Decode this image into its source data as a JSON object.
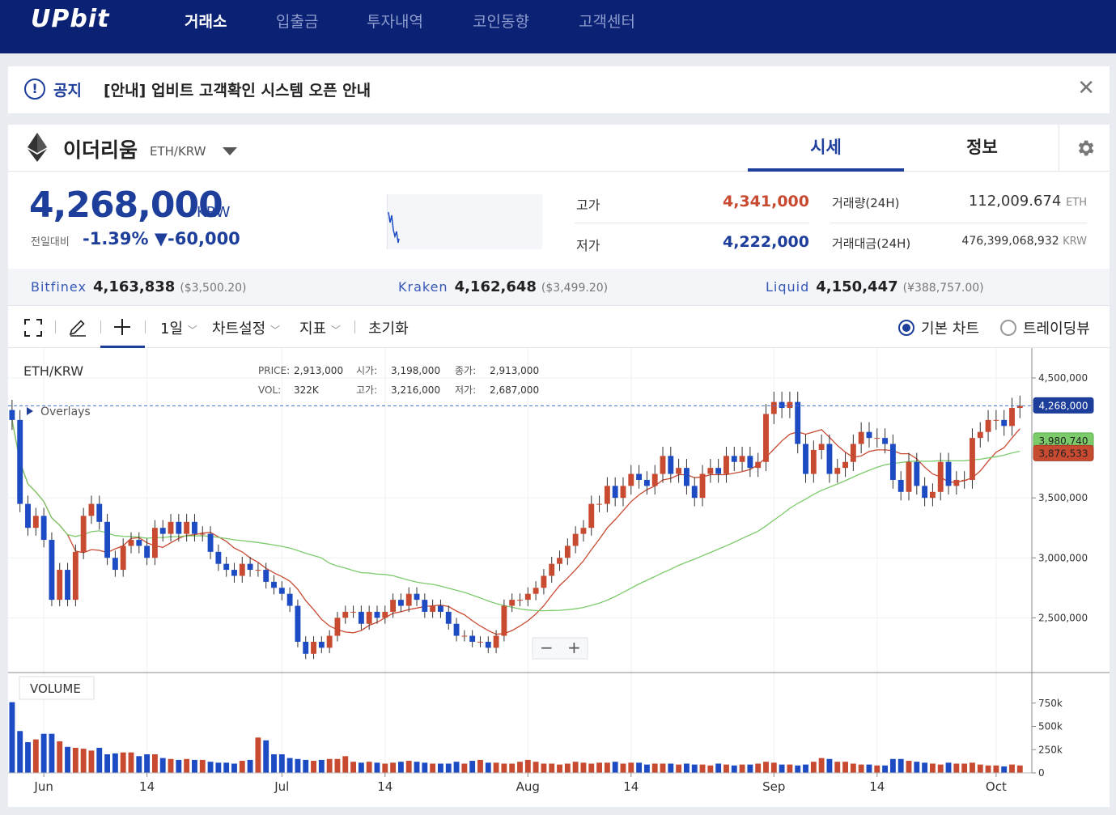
{
  "nav": {
    "logo": "UPbit",
    "items": [
      {
        "label": "거래소",
        "active": true
      },
      {
        "label": "입출금",
        "active": false
      },
      {
        "label": "투자내역",
        "active": false
      },
      {
        "label": "코인동향",
        "active": false
      },
      {
        "label": "고객센터",
        "active": false
      }
    ]
  },
  "notice": {
    "icon": "!",
    "label": "공지",
    "text": "[안내] 업비트 고객확인 시스템 오픈 안내",
    "close": "✕"
  },
  "coin": {
    "name": "이더리움",
    "pair": "ETH/KRW",
    "tabs": {
      "price": "시세",
      "info": "정보"
    },
    "price": "4,268,000",
    "price_unit": "KRW",
    "change_label": "전일대비",
    "change_pct": "-1.39%",
    "change_amt": "▼-60,000",
    "high_label": "고가",
    "high": "4,341,000",
    "low_label": "저가",
    "low": "4,222,000",
    "volume_label": "거래량(24H)",
    "volume": "112,009.674",
    "volume_unit": "ETH",
    "amount_label": "거래대금(24H)",
    "amount": "476,399,068,932",
    "amount_unit": "KRW"
  },
  "exchanges": [
    {
      "name": "Bitfinex",
      "price": "4,163,838",
      "foreign": "($3,500.20)"
    },
    {
      "name": "Kraken",
      "price": "4,162,648",
      "foreign": "($3,499.20)"
    },
    {
      "name": "Liquid",
      "price": "4,150,447",
      "foreign": "(¥388,757.00)"
    }
  ],
  "toolbar": {
    "interval": "1일",
    "chart_settings": "차트설정",
    "indicators": "지표",
    "reset": "초기화",
    "basic_chart": "기본 차트",
    "tradingview": "트레이딩뷰"
  },
  "colors": {
    "up": "#c84a31",
    "down": "#1d4bc4",
    "ma_short": "#c84a31",
    "ma_long": "#7ccb6b",
    "brand": "#0a2174"
  },
  "chart_data": {
    "type": "candlestick",
    "symbol": "ETH/KRW",
    "overlays_label": "Overlays",
    "volume_label": "VOLUME",
    "legend": {
      "price_label": "PRICE:",
      "price": "2,913,000",
      "open_label": "시가:",
      "open": "3,198,000",
      "close_label": "종가:",
      "close": "2,913,000",
      "vol_label": "VOL:",
      "vol": "322K",
      "high_label": "고가:",
      "high": "3,216,000",
      "low_label": "저가:",
      "low": "2,687,000"
    },
    "y_ticks": [
      "4,500,000",
      "3,500,000",
      "3,000,000",
      "2,500,000"
    ],
    "y_tick_values": [
      4500000,
      3500000,
      3000000,
      2500000
    ],
    "volume_ticks": [
      "750k",
      "500k",
      "250k",
      "0"
    ],
    "volume_tick_values": [
      750000,
      500000,
      250000,
      0
    ],
    "x_labels": [
      "Jun",
      "14",
      "Jul",
      "14",
      "Aug",
      "14",
      "Sep",
      "14",
      "Oct"
    ],
    "x_label_days": [
      4,
      17,
      34,
      47,
      65,
      78,
      96,
      109,
      124
    ],
    "last_price": 4268000,
    "last_price_label": "4,268,000",
    "ma_long_last": "3,980,740",
    "ma_short_last": "3,876,533",
    "ylim": [
      2050000,
      4750000
    ],
    "closes": [
      4150000,
      3450000,
      3250000,
      3350000,
      3150000,
      2650000,
      2900000,
      2650000,
      3050000,
      3350000,
      3450000,
      3300000,
      3000000,
      2900000,
      3100000,
      3150000,
      3100000,
      3000000,
      3250000,
      3200000,
      3300000,
      3200000,
      3300000,
      3200000,
      3200000,
      3050000,
      2950000,
      2900000,
      2850000,
      2950000,
      2900000,
      2900000,
      2800000,
      2750000,
      2700000,
      2600000,
      2300000,
      2200000,
      2300000,
      2250000,
      2350000,
      2500000,
      2550000,
      2550000,
      2450000,
      2550000,
      2500000,
      2550000,
      2650000,
      2600000,
      2700000,
      2650000,
      2550000,
      2600000,
      2550000,
      2450000,
      2350000,
      2350000,
      2300000,
      2300000,
      2250000,
      2350000,
      2600000,
      2650000,
      2650000,
      2700000,
      2750000,
      2850000,
      2950000,
      3000000,
      3100000,
      3200000,
      3250000,
      3450000,
      3450000,
      3600000,
      3500000,
      3600000,
      3700000,
      3650000,
      3600000,
      3700000,
      3850000,
      3700000,
      3750000,
      3600000,
      3500000,
      3700000,
      3750000,
      3700000,
      3850000,
      3800000,
      3850000,
      3750000,
      3800000,
      4200000,
      4300000,
      4250000,
      4300000,
      3950000,
      3700000,
      3900000,
      3950000,
      3700000,
      3750000,
      3800000,
      3950000,
      4050000,
      4000000,
      4000000,
      3950000,
      3650000,
      3550000,
      3800000,
      3600000,
      3500000,
      3550000,
      3800000,
      3600000,
      3650000,
      3650000,
      4000000,
      4050000,
      4150000,
      4150000,
      4100000,
      4250000,
      4268000
    ],
    "volumes": [
      760000,
      450000,
      330000,
      360000,
      420000,
      420000,
      340000,
      280000,
      270000,
      260000,
      240000,
      270000,
      200000,
      210000,
      220000,
      220000,
      180000,
      200000,
      200000,
      160000,
      150000,
      140000,
      150000,
      140000,
      140000,
      120000,
      110000,
      110000,
      100000,
      130000,
      140000,
      380000,
      350000,
      200000,
      200000,
      160000,
      150000,
      140000,
      130000,
      140000,
      150000,
      150000,
      180000,
      120000,
      110000,
      120000,
      110000,
      100000,
      110000,
      120000,
      130000,
      120000,
      110000,
      100000,
      100000,
      100000,
      120000,
      100000,
      130000,
      140000,
      110000,
      110000,
      100000,
      100000,
      120000,
      140000,
      120000,
      100000,
      100000,
      90000,
      100000,
      120000,
      110000,
      100000,
      110000,
      110000,
      120000,
      100000,
      110000,
      110000,
      90000,
      100000,
      100000,
      100000,
      90000,
      100000,
      90000,
      90000,
      80000,
      100000,
      90000,
      80000,
      90000,
      90000,
      100000,
      120000,
      110000,
      90000,
      90000,
      80000,
      90000,
      120000,
      160000,
      150000,
      120000,
      120000,
      100000,
      90000,
      90000,
      80000,
      80000,
      150000,
      150000,
      130000,
      120000,
      110000,
      100000,
      90000,
      110000,
      100000,
      100000,
      110000,
      90000,
      80000,
      80000,
      70000,
      90000,
      80000
    ]
  }
}
